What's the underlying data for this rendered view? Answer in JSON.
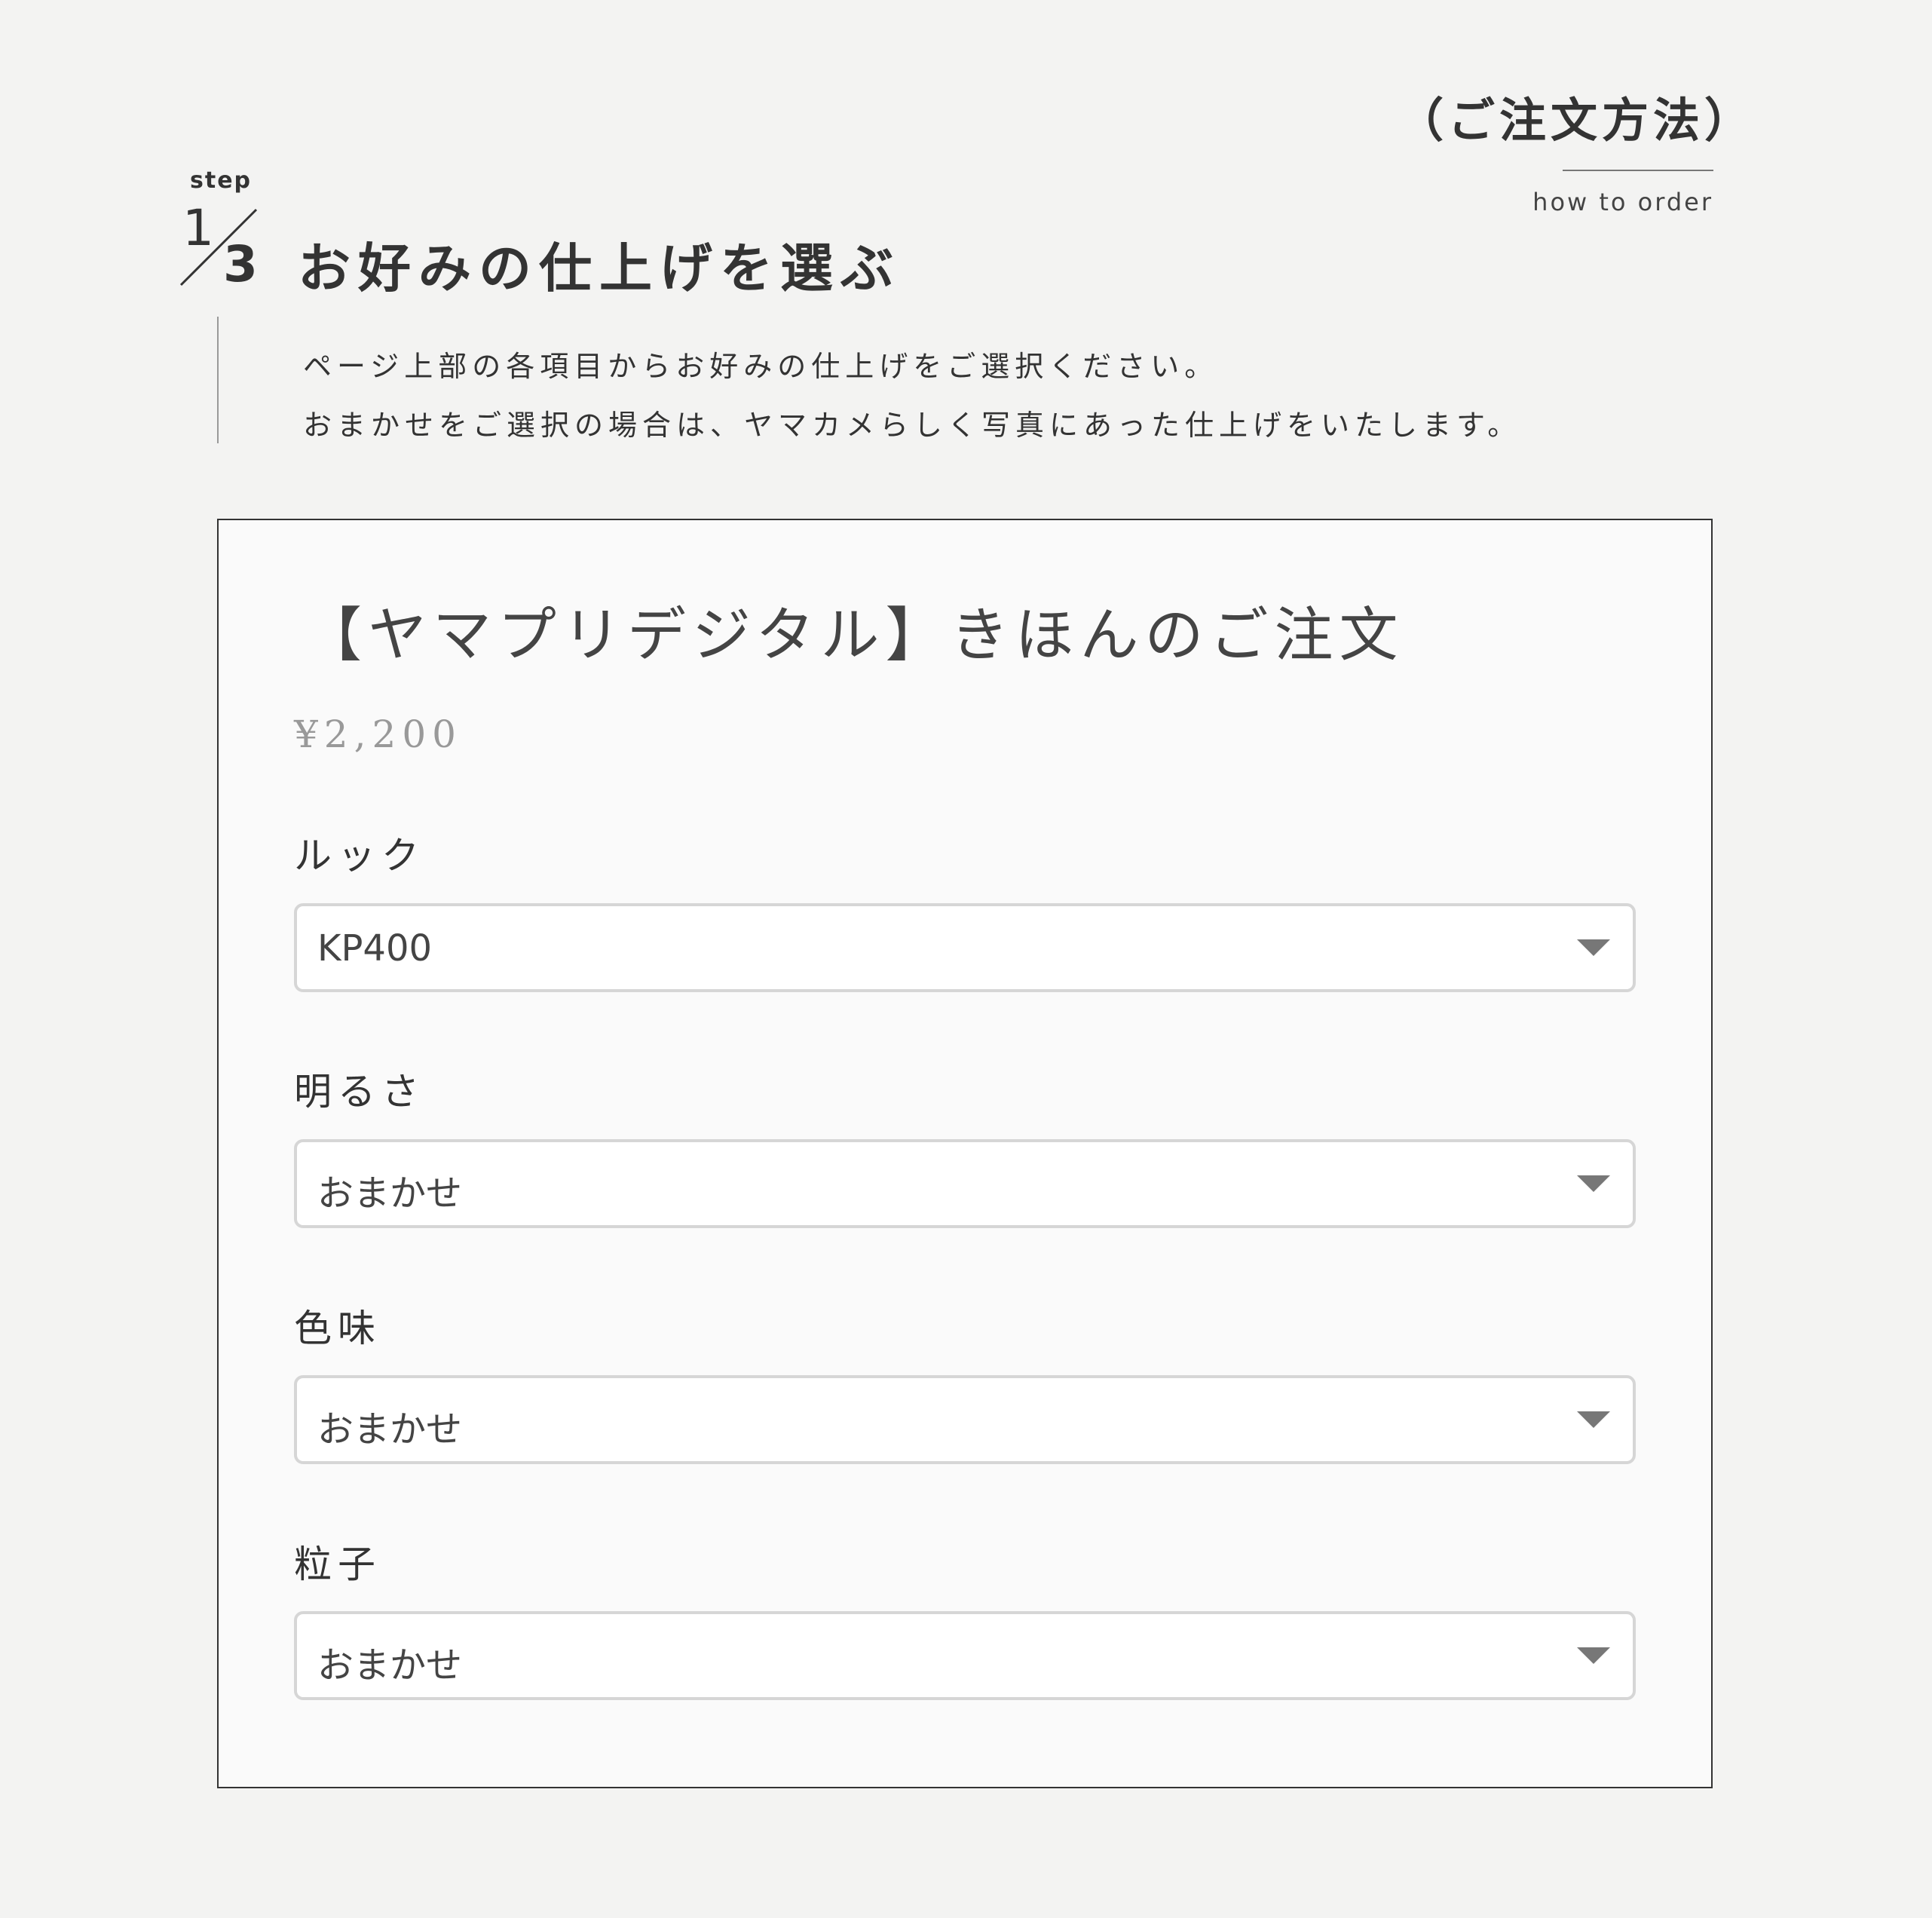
{
  "header": {
    "title_jp": "（ご注文方法）",
    "title_en": "how to order"
  },
  "step": {
    "word": "step",
    "current": "1",
    "total": "3",
    "title": "お好みの仕上げを選ぶ"
  },
  "description": {
    "line1": "ページ上部の各項目からお好みの仕上げをご選択ください。",
    "line2": "おまかせをご選択の場合は、ヤマカメらしく写真にあった仕上げをいたします。"
  },
  "product": {
    "title": "【ヤマプリデジタル】きほんのご注文",
    "price": "¥2,200"
  },
  "options": [
    {
      "label": "ルック",
      "value": "KP400"
    },
    {
      "label": "明るさ",
      "value": "おまかせ"
    },
    {
      "label": "色味",
      "value": "おまかせ"
    },
    {
      "label": "粒子",
      "value": "おまかせ"
    }
  ],
  "icons": {
    "dropdown": "caret-down-icon"
  }
}
